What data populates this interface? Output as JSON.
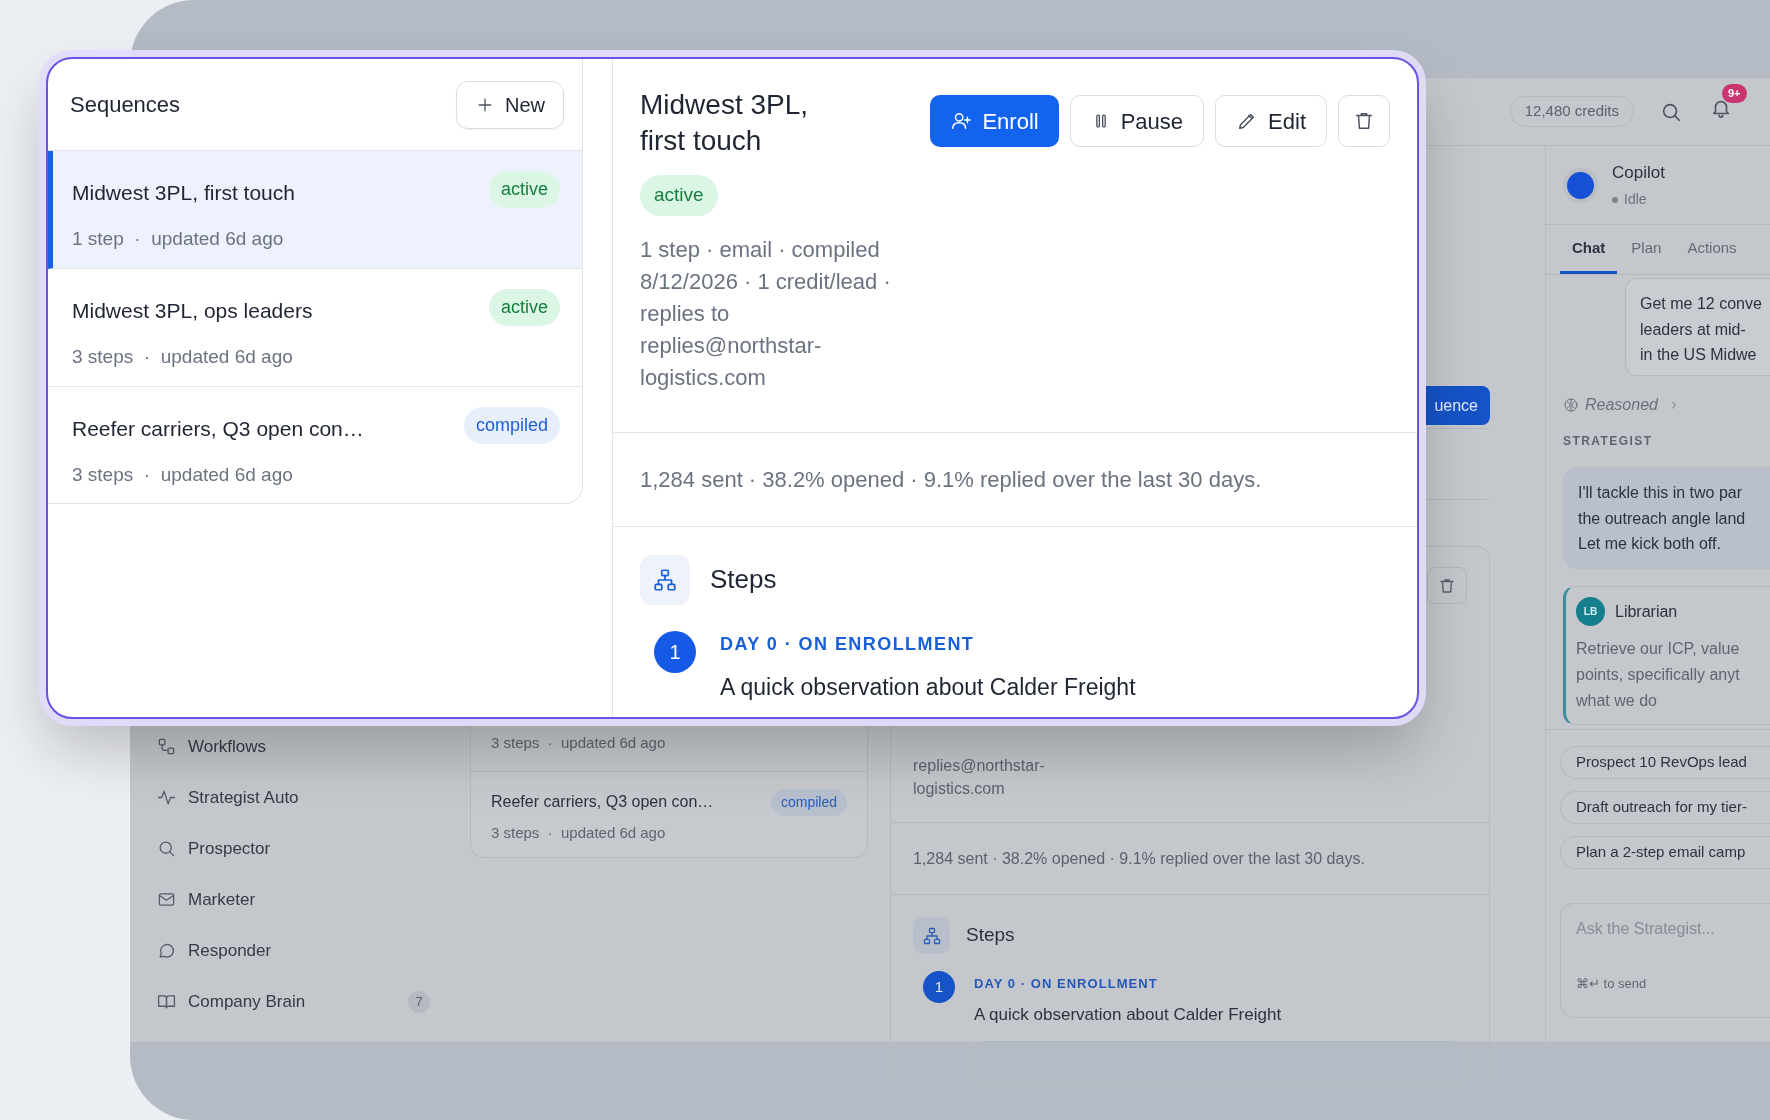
{
  "app": {
    "header": {
      "credits": "12,480 credits",
      "notification_badge": "9+"
    },
    "sidebar": {
      "items": [
        {
          "label": "Workflows"
        },
        {
          "label": "Strategist Auto"
        },
        {
          "label": "Prospector"
        },
        {
          "label": "Marketer"
        },
        {
          "label": "Responder"
        },
        {
          "label": "Company Brain",
          "count": "7"
        }
      ]
    },
    "sequence_list": {
      "rows": [
        {
          "meta": "3 steps  ·  updated 6d ago"
        },
        {
          "title": "Reefer carriers, Q3 open con…",
          "status": {
            "label": "compiled",
            "kind": "info"
          },
          "meta": "3 steps  ·  updated 6d ago"
        }
      ]
    },
    "detail": {
      "header_button": "uence",
      "contact_lines": [
        "replies@northstar-",
        "logistics.com"
      ],
      "stats": "1,284 sent · 38.2% opened · 9.1% replied over the last 30 days.",
      "steps_title": "Steps",
      "steps": [
        {
          "number": "1",
          "timing": "DAY 0 · ON ENROLLMENT",
          "subject": "A quick observation about Calder Freight"
        }
      ]
    },
    "copilot": {
      "title": "Copilot",
      "status": "Idle",
      "tabs": [
        {
          "label": "Chat",
          "selected": true
        },
        {
          "label": "Plan",
          "selected": false
        },
        {
          "label": "Actions",
          "selected": false
        }
      ],
      "user_message": [
        "Get me 12 conve",
        "leaders at mid-",
        "in the US Midwe"
      ],
      "reasoning": "Reasoned",
      "role_label": "STRATEGIST",
      "strategist_message": [
        "I'll tackle this in two par",
        "the outreach angle land",
        "Let me kick both off."
      ],
      "delegation": {
        "initials": "LB",
        "name": "Librarian",
        "lines": [
          "Retrieve our ICP, value",
          "points, specifically anyt",
          "what we do"
        ]
      },
      "suggestions": [
        "Prospect 10 RevOps lead",
        "Draft outreach for my tier-",
        "Plan a 2-step email camp"
      ],
      "composer": {
        "placeholder": "Ask the Strategist...",
        "hint": "⌘↵ to send"
      }
    }
  },
  "callout": {
    "list": {
      "title": "Sequences",
      "new_button": "New",
      "rows": [
        {
          "title": "Midwest 3PL, first touch",
          "status": {
            "label": "active",
            "kind": "success"
          },
          "meta": "1 step  ·  updated 6d ago",
          "selected": true
        },
        {
          "title": "Midwest 3PL, ops leaders",
          "status": {
            "label": "active",
            "kind": "success"
          },
          "meta": "3 steps  ·  updated 6d ago",
          "selected": false
        },
        {
          "title": "Reefer carriers, Q3 open con…",
          "status": {
            "label": "compiled",
            "kind": "info"
          },
          "meta": "3 steps  ·  updated 6d ago",
          "selected": false
        }
      ]
    },
    "detail": {
      "title": "Midwest 3PL, first touch",
      "buttons": [
        {
          "label": "Enroll",
          "kind": "primary"
        },
        {
          "label": "Pause",
          "kind": "pause"
        },
        {
          "label": "Edit",
          "kind": "edit"
        },
        {
          "kind": "delete"
        }
      ],
      "status": {
        "label": "active",
        "kind": "success"
      },
      "meta": "1 step · email · compiled 8/12/2026 · 1 credit/lead · replies to replies@northstar-logistics.com",
      "stats": "1,284 sent · 38.2% opened · 9.1% replied over the last 30 days.",
      "steps_title": "Steps",
      "steps": [
        {
          "number": "1",
          "timing": "DAY 0 · ON ENROLLMENT",
          "subject": "A quick observation about Calder Freight"
        }
      ]
    }
  }
}
